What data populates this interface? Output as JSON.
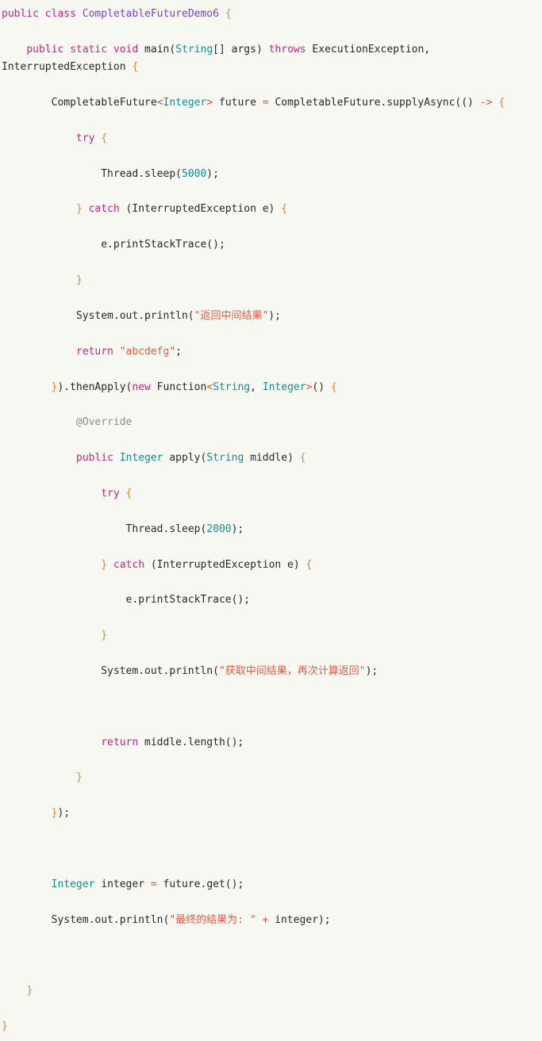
{
  "document": {
    "kind": "code-block",
    "language": "java",
    "background_color": "#f8f8f3",
    "class_name": "CompletableFutureDemo6"
  },
  "theme": {
    "keyword_color": "#d4237a",
    "class_name_color": "#7b3fe4",
    "type_color": "#13918c",
    "string_color": "#ee5a42",
    "number_color": "#13918c",
    "annotation_color": "#8d8d8d",
    "punctuation_color": "#d98a3a",
    "operator_color": "#e0533a",
    "plain_color": "#24292e"
  },
  "code": {
    "lines": [
      {
        "id": "l1",
        "tokens": [
          {
            "t": "public",
            "c": "kw"
          },
          {
            "t": " ",
            "c": "pl"
          },
          {
            "t": "class",
            "c": "kw"
          },
          {
            "t": " ",
            "c": "pl"
          },
          {
            "t": "CompletableFutureDemo6",
            "c": "cls"
          },
          {
            "t": " ",
            "c": "pl"
          },
          {
            "t": "{",
            "c": "pun"
          }
        ]
      },
      {
        "id": "l2",
        "tokens": [
          {
            "t": "    ",
            "c": "pl"
          },
          {
            "t": "public",
            "c": "kw"
          },
          {
            "t": " ",
            "c": "pl"
          },
          {
            "t": "static",
            "c": "kw"
          },
          {
            "t": " ",
            "c": "pl"
          },
          {
            "t": "void",
            "c": "kw"
          },
          {
            "t": " ",
            "c": "pl"
          },
          {
            "t": "main",
            "c": "pl"
          },
          {
            "t": "(",
            "c": "pl"
          },
          {
            "t": "String",
            "c": "typ"
          },
          {
            "t": "[] args) ",
            "c": "pl"
          },
          {
            "t": "throws",
            "c": "kw"
          },
          {
            "t": " ExecutionException, InterruptedException ",
            "c": "pl"
          },
          {
            "t": "{",
            "c": "pun"
          }
        ]
      },
      {
        "id": "l3",
        "tokens": [
          {
            "t": "        CompletableFuture",
            "c": "pl"
          },
          {
            "t": "<",
            "c": "op"
          },
          {
            "t": "Integer",
            "c": "typ"
          },
          {
            "t": ">",
            "c": "op"
          },
          {
            "t": " future ",
            "c": "pl"
          },
          {
            "t": "=",
            "c": "op"
          },
          {
            "t": " CompletableFuture.supplyAsync(() ",
            "c": "pl"
          },
          {
            "t": "->",
            "c": "op"
          },
          {
            "t": " ",
            "c": "pl"
          },
          {
            "t": "{",
            "c": "pun"
          }
        ]
      },
      {
        "id": "l4",
        "tokens": [
          {
            "t": "            ",
            "c": "pl"
          },
          {
            "t": "try",
            "c": "kw"
          },
          {
            "t": " ",
            "c": "pl"
          },
          {
            "t": "{",
            "c": "pun"
          }
        ]
      },
      {
        "id": "l5",
        "tokens": [
          {
            "t": "                Thread.sleep(",
            "c": "pl"
          },
          {
            "t": "5000",
            "c": "num"
          },
          {
            "t": ");",
            "c": "pl"
          }
        ]
      },
      {
        "id": "l6",
        "tokens": [
          {
            "t": "            ",
            "c": "pl"
          },
          {
            "t": "}",
            "c": "pun"
          },
          {
            "t": " ",
            "c": "pl"
          },
          {
            "t": "catch",
            "c": "kw"
          },
          {
            "t": " (InterruptedException e) ",
            "c": "pl"
          },
          {
            "t": "{",
            "c": "pun"
          }
        ]
      },
      {
        "id": "l7",
        "tokens": [
          {
            "t": "                e.printStackTrace();",
            "c": "pl"
          }
        ]
      },
      {
        "id": "l8",
        "tokens": [
          {
            "t": "            ",
            "c": "pl"
          },
          {
            "t": "}",
            "c": "pun"
          }
        ]
      },
      {
        "id": "l9",
        "tokens": [
          {
            "t": "            System.out.println(",
            "c": "pl"
          },
          {
            "t": "\"返回中间结果\"",
            "c": "str"
          },
          {
            "t": ");",
            "c": "pl"
          }
        ]
      },
      {
        "id": "l10",
        "tokens": [
          {
            "t": "            ",
            "c": "pl"
          },
          {
            "t": "return",
            "c": "kw"
          },
          {
            "t": " ",
            "c": "pl"
          },
          {
            "t": "\"abcdefg\"",
            "c": "str"
          },
          {
            "t": ";",
            "c": "pl"
          }
        ]
      },
      {
        "id": "l11",
        "tokens": [
          {
            "t": "        ",
            "c": "pl"
          },
          {
            "t": "}",
            "c": "pun"
          },
          {
            "t": ").thenApply(",
            "c": "pl"
          },
          {
            "t": "new",
            "c": "kw"
          },
          {
            "t": " Function",
            "c": "pl"
          },
          {
            "t": "<",
            "c": "op"
          },
          {
            "t": "String",
            "c": "typ"
          },
          {
            "t": ", ",
            "c": "pl"
          },
          {
            "t": "Integer",
            "c": "typ"
          },
          {
            "t": ">",
            "c": "op"
          },
          {
            "t": "() ",
            "c": "pl"
          },
          {
            "t": "{",
            "c": "pun"
          }
        ]
      },
      {
        "id": "l12",
        "tokens": [
          {
            "t": "            ",
            "c": "pl"
          },
          {
            "t": "@Override",
            "c": "anno"
          }
        ]
      },
      {
        "id": "l13",
        "tokens": [
          {
            "t": "            ",
            "c": "pl"
          },
          {
            "t": "public",
            "c": "kw"
          },
          {
            "t": " ",
            "c": "pl"
          },
          {
            "t": "Integer",
            "c": "typ"
          },
          {
            "t": " apply(",
            "c": "pl"
          },
          {
            "t": "String",
            "c": "typ"
          },
          {
            "t": " middle) ",
            "c": "pl"
          },
          {
            "t": "{",
            "c": "pun"
          }
        ]
      },
      {
        "id": "l14",
        "tokens": [
          {
            "t": "                ",
            "c": "pl"
          },
          {
            "t": "try",
            "c": "kw"
          },
          {
            "t": " ",
            "c": "pl"
          },
          {
            "t": "{",
            "c": "pun"
          }
        ]
      },
      {
        "id": "l15",
        "tokens": [
          {
            "t": "                    Thread.sleep(",
            "c": "pl"
          },
          {
            "t": "2000",
            "c": "num"
          },
          {
            "t": ");",
            "c": "pl"
          }
        ]
      },
      {
        "id": "l16",
        "tokens": [
          {
            "t": "                ",
            "c": "pl"
          },
          {
            "t": "}",
            "c": "pun"
          },
          {
            "t": " ",
            "c": "pl"
          },
          {
            "t": "catch",
            "c": "kw"
          },
          {
            "t": " (InterruptedException e) ",
            "c": "pl"
          },
          {
            "t": "{",
            "c": "pun"
          }
        ]
      },
      {
        "id": "l17",
        "tokens": [
          {
            "t": "                    e.printStackTrace();",
            "c": "pl"
          }
        ]
      },
      {
        "id": "l18",
        "tokens": [
          {
            "t": "                ",
            "c": "pl"
          },
          {
            "t": "}",
            "c": "pun"
          }
        ]
      },
      {
        "id": "l19",
        "tokens": [
          {
            "t": "                System.out.println(",
            "c": "pl"
          },
          {
            "t": "\"获取中间结果，再次计算返回\"",
            "c": "str"
          },
          {
            "t": ");",
            "c": "pl"
          }
        ]
      },
      {
        "id": "l20",
        "tokens": []
      },
      {
        "id": "l21",
        "tokens": [
          {
            "t": "                ",
            "c": "pl"
          },
          {
            "t": "return",
            "c": "kw"
          },
          {
            "t": " middle.length();",
            "c": "pl"
          }
        ]
      },
      {
        "id": "l22",
        "tokens": [
          {
            "t": "            ",
            "c": "pl"
          },
          {
            "t": "}",
            "c": "pun"
          }
        ]
      },
      {
        "id": "l23",
        "tokens": [
          {
            "t": "        ",
            "c": "pl"
          },
          {
            "t": "}",
            "c": "pun"
          },
          {
            "t": ");",
            "c": "pl"
          }
        ]
      },
      {
        "id": "l24",
        "tokens": []
      },
      {
        "id": "l25",
        "tokens": [
          {
            "t": "        ",
            "c": "pl"
          },
          {
            "t": "Integer",
            "c": "typ"
          },
          {
            "t": " integer ",
            "c": "pl"
          },
          {
            "t": "=",
            "c": "op"
          },
          {
            "t": " future.get();",
            "c": "pl"
          }
        ]
      },
      {
        "id": "l26",
        "tokens": [
          {
            "t": "        System.out.println(",
            "c": "pl"
          },
          {
            "t": "\"最终的结果为: \"",
            "c": "str"
          },
          {
            "t": " ",
            "c": "pl"
          },
          {
            "t": "+",
            "c": "op"
          },
          {
            "t": " integer);",
            "c": "pl"
          }
        ]
      },
      {
        "id": "l27",
        "tokens": []
      },
      {
        "id": "l28",
        "tokens": [
          {
            "t": "    ",
            "c": "pl"
          },
          {
            "t": "}",
            "c": "pun"
          }
        ]
      },
      {
        "id": "l29",
        "tokens": [
          {
            "t": "}",
            "c": "pun"
          }
        ]
      }
    ]
  }
}
